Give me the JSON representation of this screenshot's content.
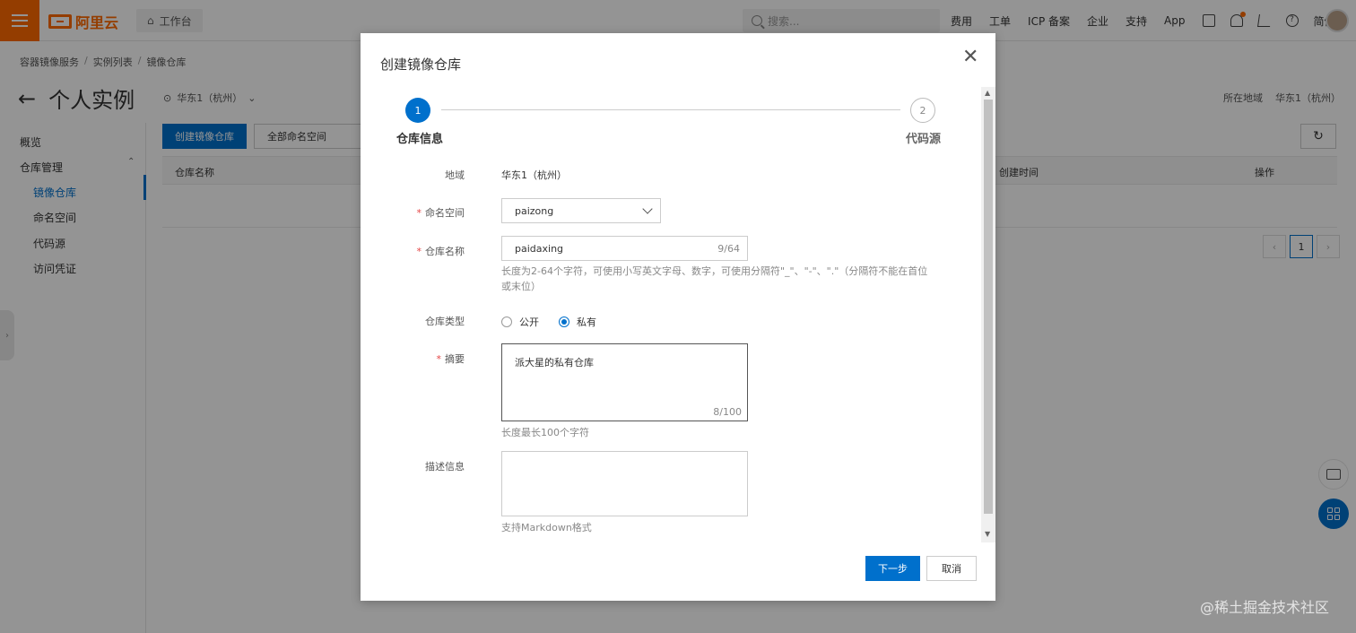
{
  "topbar": {
    "logo_text": "阿里云",
    "workbench_label": "工作台",
    "search_placeholder": "搜索...",
    "nav": [
      "费用",
      "工单",
      "ICP 备案",
      "企业",
      "支持",
      "App"
    ],
    "lang": "简体"
  },
  "breadcrumb": [
    "容器镜像服务",
    "实例列表",
    "镜像仓库"
  ],
  "header": {
    "title": "个人实例",
    "region": "华东1（杭州）",
    "region_label": "所在地域",
    "region_value": "华东1（杭州）"
  },
  "sidebar": {
    "overview": "概览",
    "repo_mgmt": "仓库管理",
    "items": [
      "镜像仓库",
      "命名空间",
      "代码源",
      "访问凭证"
    ]
  },
  "main": {
    "create_button": "创建镜像仓库",
    "namespace_filter": "全部命名空间",
    "columns": [
      "仓库名称",
      "创建时间",
      "操作"
    ],
    "page": "1"
  },
  "dialog": {
    "title": "创建镜像仓库",
    "steps": [
      {
        "num": "1",
        "label": "仓库信息"
      },
      {
        "num": "2",
        "label": "代码源"
      }
    ],
    "region_label": "地域",
    "region_value": "华东1（杭州）",
    "namespace_label": "命名空间",
    "namespace_value": "paizong",
    "name_label": "仓库名称",
    "name_value": "paidaxing",
    "name_count": "9/64",
    "name_hint_line1": "长度为2-64个字符，可使用小写英文字母、数字，可使用分隔符\"_\"、\"-\"、\".\"（分隔符不能在首位",
    "name_hint_line2": "或末位）",
    "type_label": "仓库类型",
    "type_public": "公开",
    "type_private": "私有",
    "summary_label": "摘要",
    "summary_value": "派大星的私有仓库",
    "summary_count": "8/100",
    "summary_hint": "长度最长100个字符",
    "desc_label": "描述信息",
    "desc_hint": "支持Markdown格式",
    "next_button": "下一步",
    "cancel_button": "取消"
  },
  "watermark": "@稀土掘金技术社区",
  "colors": {
    "brand": "#ff6a00",
    "primary": "#0070cc",
    "required": "#e54545"
  }
}
